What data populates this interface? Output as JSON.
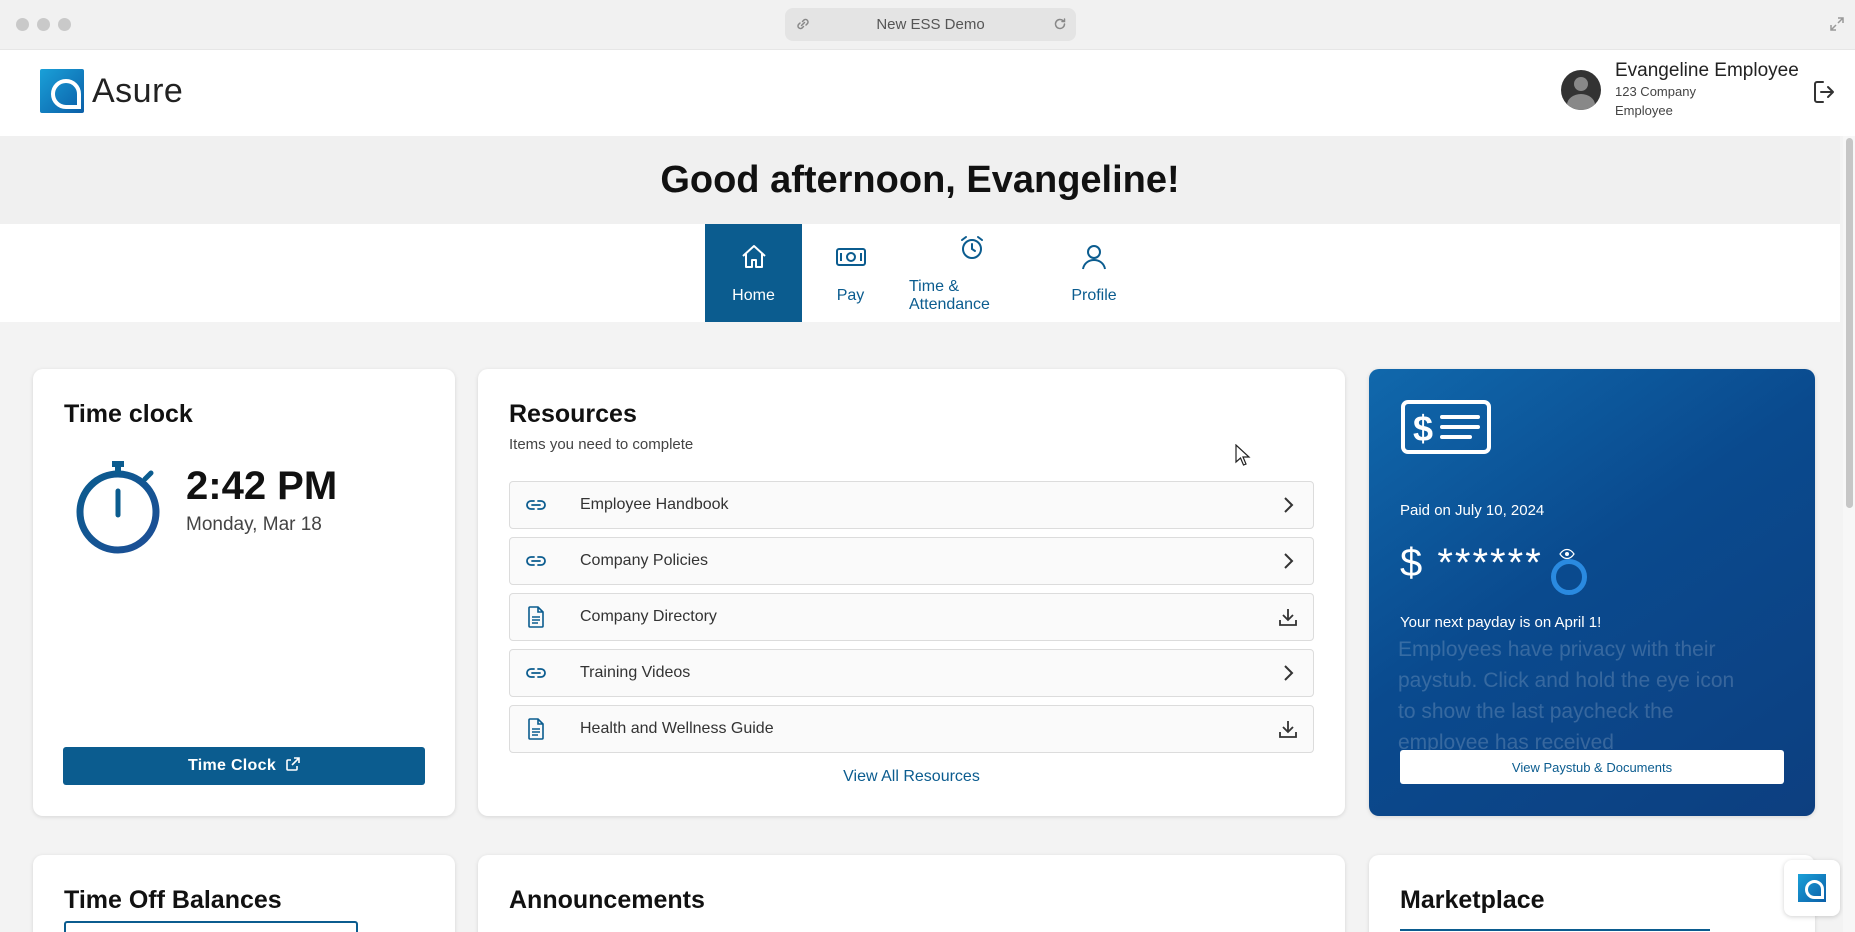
{
  "browser": {
    "url_title": "New ESS Demo"
  },
  "brand": {
    "name": "Asure"
  },
  "user": {
    "name": "Evangeline Employee",
    "company": "123 Company",
    "role": "Employee"
  },
  "greeting": "Good afternoon, Evangeline!",
  "nav": [
    {
      "label": "Home",
      "icon": "home-icon",
      "active": true
    },
    {
      "label": "Pay",
      "icon": "money-icon",
      "active": false
    },
    {
      "label": "Time & Attendance",
      "icon": "alarm-clock-icon",
      "active": false
    },
    {
      "label": "Profile",
      "icon": "person-icon",
      "active": false
    }
  ],
  "time_clock": {
    "title": "Time clock",
    "time": "2:42 PM",
    "date": "Monday, Mar 18",
    "button_label": "Time Clock"
  },
  "resources": {
    "title": "Resources",
    "subtitle": "Items you need to complete",
    "items": [
      {
        "label": "Employee Handbook",
        "icon": "link-icon",
        "action": "chevron-right-icon"
      },
      {
        "label": "Company Policies",
        "icon": "link-icon",
        "action": "chevron-right-icon"
      },
      {
        "label": "Company Directory",
        "icon": "document-icon",
        "action": "download-icon"
      },
      {
        "label": "Training Videos",
        "icon": "link-icon",
        "action": "chevron-right-icon"
      },
      {
        "label": "Health and Wellness Guide",
        "icon": "document-icon",
        "action": "download-icon"
      }
    ],
    "view_all": "View All Resources"
  },
  "pay": {
    "paid_on": "Paid on July 10, 2024",
    "amount_masked": "$ ******",
    "next_payday": "Your next payday is on April 1!",
    "privacy_hint": "Employees have privacy with their paystub. Click and hold the eye icon to show the last paycheck the employee has received",
    "button_label": "View Paystub & Documents"
  },
  "bottom_cards": {
    "time_off": "Time Off Balances",
    "announcements": "Announcements",
    "marketplace": "Marketplace"
  },
  "colors": {
    "primary": "#0b5c8f",
    "pay_card_start": "#1068ac",
    "pay_card_end": "#0d3f80"
  }
}
